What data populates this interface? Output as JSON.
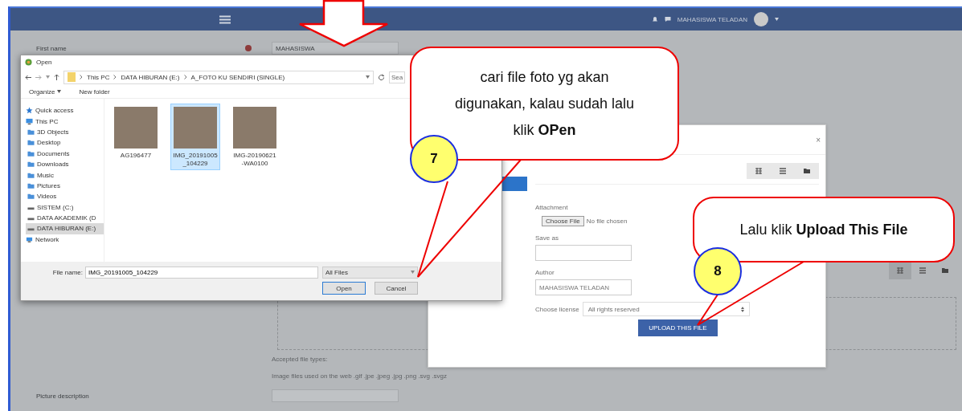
{
  "navbar": {
    "user_name": "MAHASISWA TELADAN"
  },
  "form": {
    "first_name_label": "First name",
    "first_name_value": "MAHASISWA",
    "accepted_types_label": "Accepted file types:",
    "accepted_types_text": "Image files used on the web .gif .jpe .jpeg .jpg .png .svg .svgz",
    "picture_description_label": "Picture description"
  },
  "open_dialog": {
    "title": "Open",
    "path": [
      "This PC",
      "DATA HIBURAN (E:)",
      "A_FOTO KU SENDIRI (SINGLE)"
    ],
    "search_placeholder": "Sea",
    "organize": "Organize",
    "new_folder": "New folder",
    "nav": [
      {
        "label": "Quick access",
        "kind": "star",
        "selected": false
      },
      {
        "label": "This PC",
        "kind": "pc",
        "selected": false,
        "children": [
          {
            "label": "3D Objects",
            "kind": "folder",
            "selected": false
          },
          {
            "label": "Desktop",
            "kind": "folder",
            "selected": false
          },
          {
            "label": "Documents",
            "kind": "folder",
            "selected": false
          },
          {
            "label": "Downloads",
            "kind": "folder",
            "selected": false
          },
          {
            "label": "Music",
            "kind": "folder",
            "selected": false
          },
          {
            "label": "Pictures",
            "kind": "folder",
            "selected": false
          },
          {
            "label": "Videos",
            "kind": "folder",
            "selected": false
          },
          {
            "label": "SISTEM (C:)",
            "kind": "drive",
            "selected": false
          },
          {
            "label": "DATA AKADEMIK (D",
            "kind": "drive",
            "selected": false
          },
          {
            "label": "DATA HIBURAN (E:)",
            "kind": "drive",
            "selected": true
          }
        ]
      },
      {
        "label": "Network",
        "kind": "network",
        "selected": false
      }
    ],
    "files": [
      {
        "name": "AG196477",
        "selected": false
      },
      {
        "name": "IMG_20191005_104229",
        "selected": true
      },
      {
        "name": "IMG-20190621-WA0100",
        "selected": false
      }
    ],
    "file_name_label": "File name:",
    "file_name": "IMG_20191005_104229",
    "filter": "All Files",
    "buttons": [
      "Open",
      "Cancel"
    ]
  },
  "upload_dialog": {
    "close": "×",
    "attachment_label": "Attachment",
    "choose_file": "Choose File",
    "no_file": "No file chosen",
    "save_as_label": "Save as",
    "author_label": "Author",
    "author_value": "MAHASISWA TELADAN",
    "license_label": "Choose license",
    "license_value": "All rights reserved",
    "upload_button": "UPLOAD THIS FILE"
  },
  "callouts": [
    {
      "step": "7",
      "text": "cari file foto yg akan digunakan, kalau sudah lalu klik **OPen**"
    },
    {
      "step": "8",
      "text": "Lalu klik  **Upload This File**"
    }
  ]
}
